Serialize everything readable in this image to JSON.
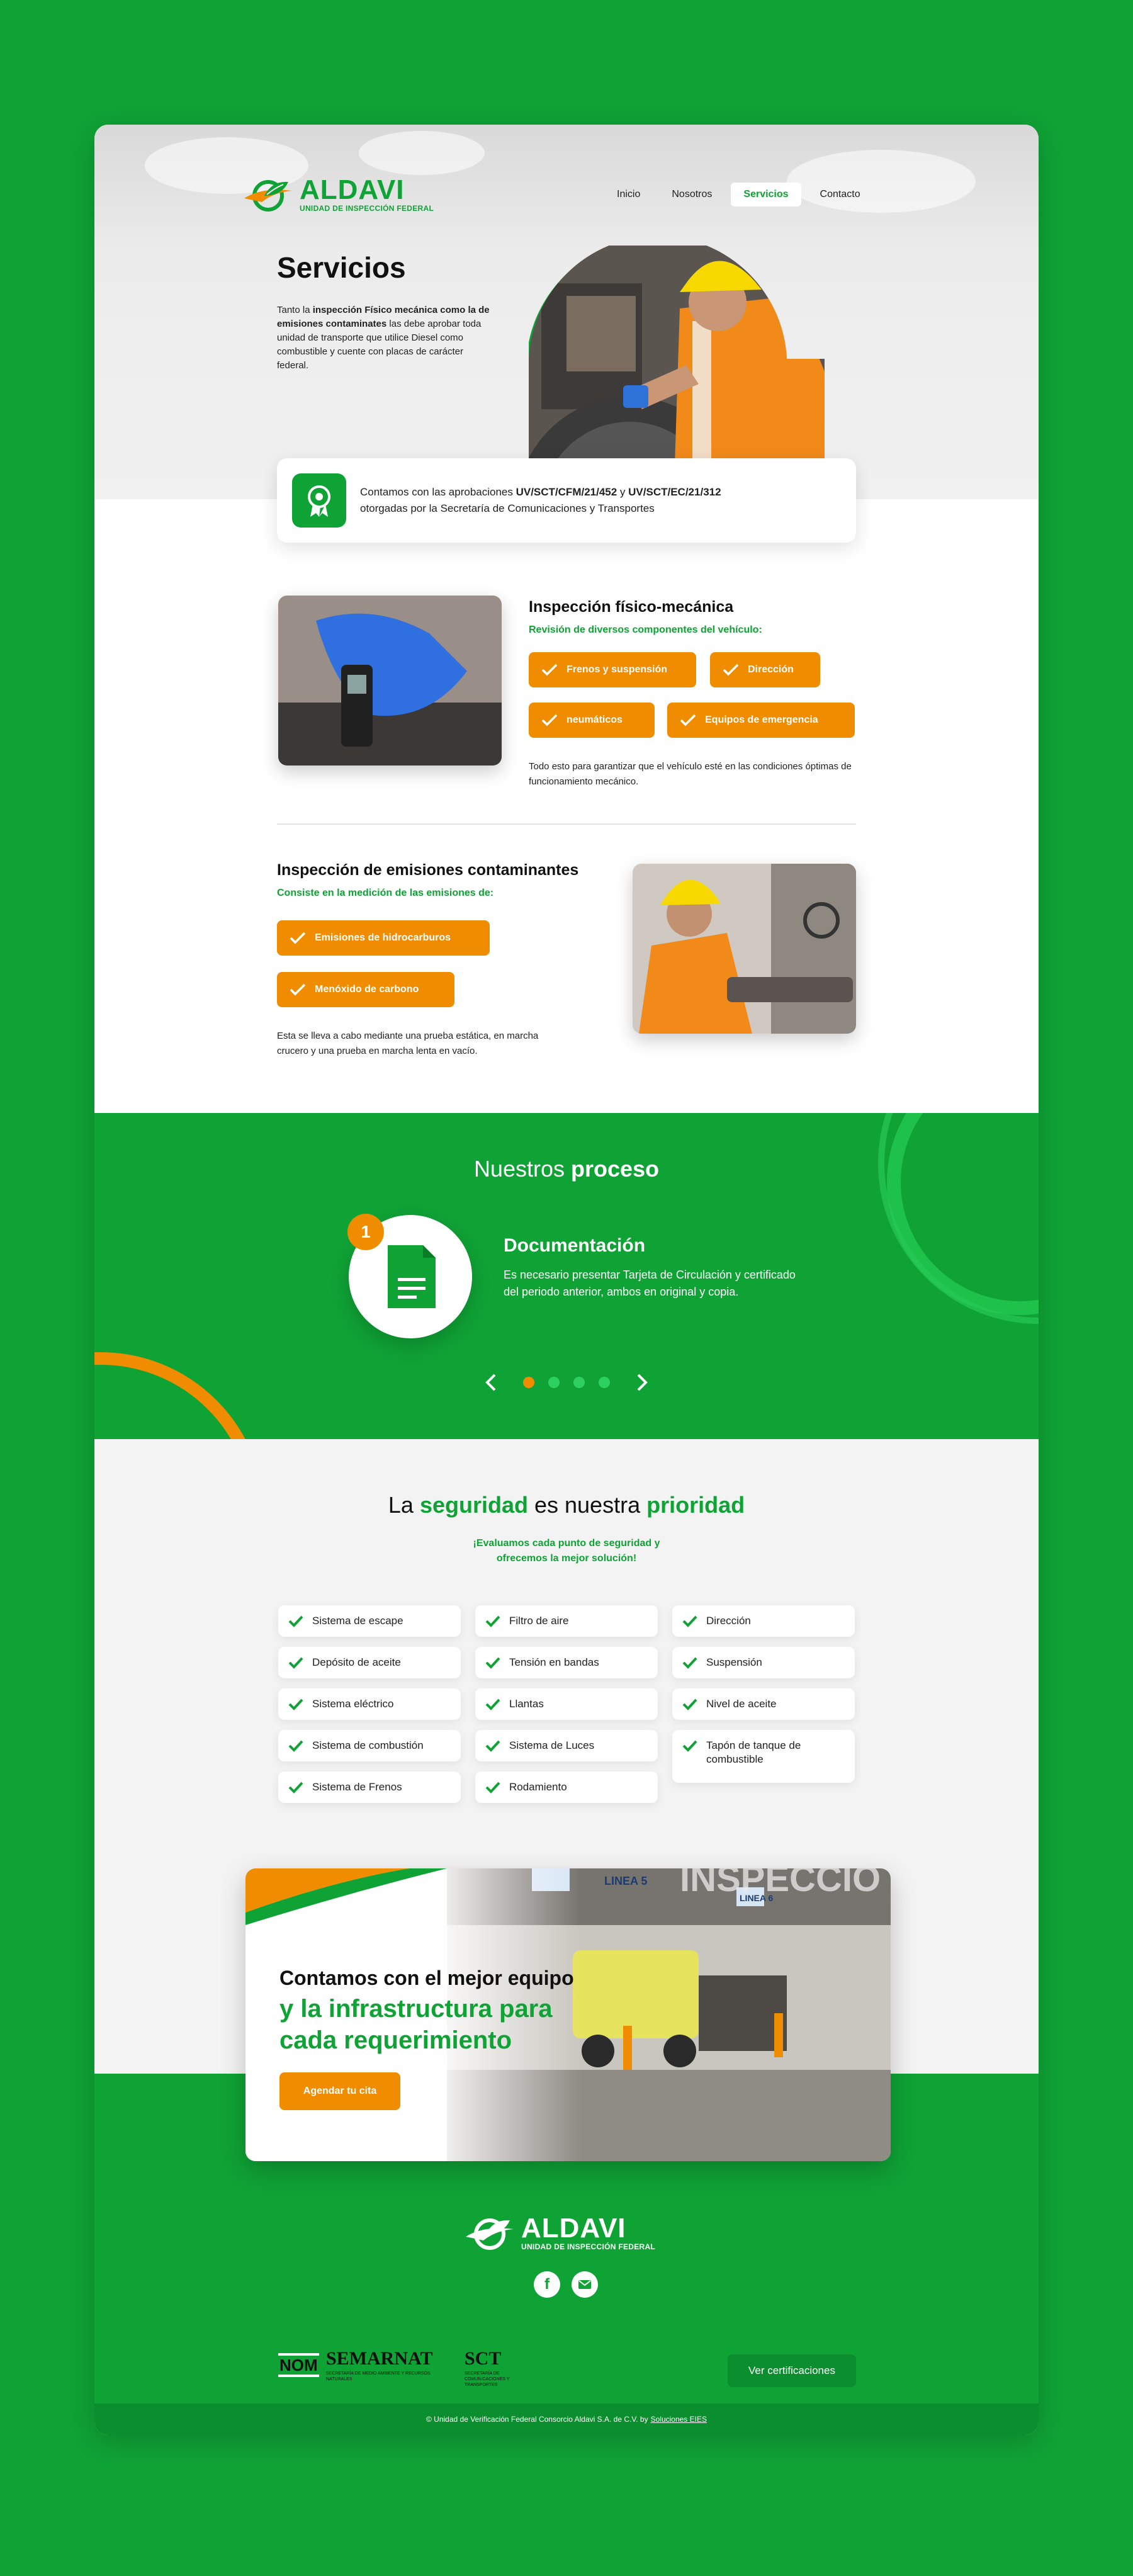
{
  "brand": {
    "name": "ALDAVI",
    "tagline": "UNIDAD DE INSPECCIÓN FEDERAL"
  },
  "nav": [
    {
      "label": "Inicio"
    },
    {
      "label": "Nosotros"
    },
    {
      "label": "Servicios",
      "active": true
    },
    {
      "label": "Contacto"
    }
  ],
  "hero": {
    "title": "Servicios",
    "intro_pre": "Tanto la ",
    "intro_bold": "inspección Físico mecánica como la de emisiones contaminates",
    "intro_post": " las debe aprobar toda unidad de transporte que utilice Diesel como combustible y cuente con placas de carácter federal."
  },
  "approvals": {
    "pre": "Contamos con las aprobaciones ",
    "code1": "UV/SCT/CFM/21/452",
    "mid": " y ",
    "code2": "UV/SCT/EC/21/312",
    "post": "otorgadas por la Secretaría de Comunicaciones y Transportes"
  },
  "physical": {
    "title": "Inspección físico-mecánica",
    "subtitle": "Revisión de diversos componentes del vehículo:",
    "items": [
      "Frenos y suspensión",
      "Dirección",
      "neumáticos",
      "Equipos de emergencia"
    ],
    "note": "Todo esto para garantizar que el vehículo esté en las condiciones óptimas de funcionamiento mecánico."
  },
  "emissions": {
    "title": "Inspección de emisiones contaminantes",
    "subtitle": "Consiste en la medición de las emisiones de:",
    "items": [
      "Emisiones de hidrocarburos",
      "Menóxido de carbono"
    ],
    "note": "Esta se lleva a cabo mediante una prueba estática, en marcha crucero y una prueba en marcha lenta en vacío."
  },
  "process": {
    "title_pre": "Nuestros ",
    "title_bold": "proceso",
    "step_number": "1",
    "step_title": "Documentación",
    "step_desc": "Es necesario presentar Tarjeta de Circulación y certificado del periodo anterior, ambos en original y copia.",
    "slides_total": 4,
    "active_slide": 1
  },
  "safety": {
    "t1": "La ",
    "t2": "seguridad",
    "t3": " es nuestra ",
    "t4": "prioridad",
    "sub1": "¡Evaluamos cada punto de seguridad y",
    "sub2": "ofrecemos la mejor solución!",
    "col1": [
      "Sistema de escape",
      "Depósito de aceite",
      "Sistema eléctrico",
      "Sistema de combustión",
      "Sistema de Frenos"
    ],
    "col2": [
      "Filtro de aire",
      "Tensión en bandas",
      "Llantas",
      "Sistema de Luces",
      "Rodamiento"
    ],
    "col3": [
      "Dirección",
      "Suspensión",
      "Nivel de aceite",
      "Tapón de tanque de combustible"
    ]
  },
  "cta": {
    "line1": "Contamos con el mejor equipo",
    "line2": "y la infrastructura para",
    "line3": "cada requerimiento",
    "button": "Agendar tu cita",
    "sign1": "LINEA 5",
    "sign2": "LINEA 6",
    "banner": "INSPECCIO"
  },
  "footer": {
    "logos": [
      "NOM",
      "SEMARNAT",
      "SCT"
    ],
    "semarnat_sub": "SECRETARÍA DE MEDIO AMBIENTE Y RECURSOS NATURALES",
    "sct_sub": "SECRETARÍA DE COMUNICACIONES Y TRANSPORTES",
    "cert_button": "Ver certificaciones",
    "copyright": "© Unidad de Verificación Federal Consorcio Aldavi S.A. de C.V. by",
    "credit": "Soluciones EIES"
  },
  "colors": {
    "green": "#0fa235",
    "orange": "#f08c00",
    "dark_green": "#0b8e2d"
  }
}
